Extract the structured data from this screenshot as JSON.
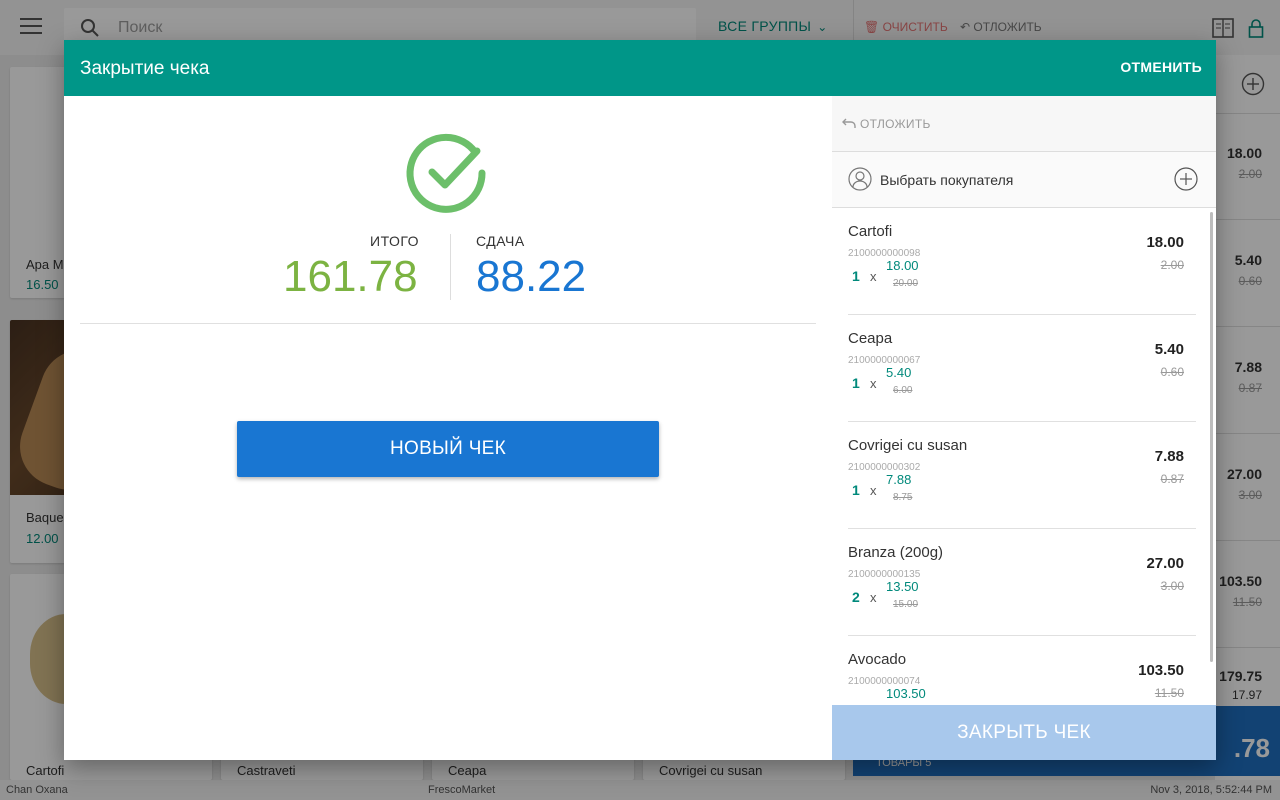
{
  "app": {
    "search_placeholder": "Поиск",
    "groups_label": "ВСЕ ГРУППЫ",
    "clear_label": "ОЧИСТИТЬ",
    "defer_label": "ОТЛОЖИТЬ",
    "tiles": [
      {
        "name": "Apa M",
        "price": "16.50"
      },
      {
        "name": "Baque",
        "price": "12.00"
      }
    ],
    "bottom_tiles": [
      "Cartofi",
      "Castraveti",
      "Ceapa",
      "Covrigei cu susan"
    ],
    "right_prices": [
      {
        "price": "18.00",
        "old": "2.00"
      },
      {
        "price": "5.40",
        "old": "0.60"
      },
      {
        "price": "7.88",
        "old": "0.87"
      },
      {
        "price": "27.00",
        "old": "3.00"
      },
      {
        "price": "103.50",
        "old": "11.50"
      },
      {
        "price": "179.75",
        "old": "17.97"
      }
    ],
    "total_big": ".78",
    "goods_label": "ТОВАРЫ  5",
    "status": {
      "cashier": "Chan Oxana",
      "store": "FrescoMarket",
      "datetime": "Nov 3, 2018, 5:52:44 PM"
    }
  },
  "modal": {
    "title": "Закрытие чека",
    "cancel_label": "ОТМЕНИТЬ",
    "total_label": "ИТОГО",
    "total_value": "161.78",
    "change_label": "СДАЧА",
    "change_value": "88.22",
    "new_check_label": "НОВЫЙ ЧЕК",
    "defer_label": "ОТЛОЖИТЬ",
    "customer_label": "Выбрать покупателя",
    "close_check_label": "ЗАКРЫТЬ ЧЕК",
    "items": [
      {
        "name": "Cartofi",
        "code": "2100000000098",
        "qty": "1",
        "unit_price": "18.00",
        "unit_old": "20.00",
        "total": "18.00",
        "discount": "2.00"
      },
      {
        "name": "Ceapa",
        "code": "2100000000067",
        "qty": "1",
        "unit_price": "5.40",
        "unit_old": "6.00",
        "total": "5.40",
        "discount": "0.60"
      },
      {
        "name": "Covrigei cu susan",
        "code": "2100000000302",
        "qty": "1",
        "unit_price": "7.88",
        "unit_old": "8.75",
        "total": "7.88",
        "discount": "0.87"
      },
      {
        "name": "Branza (200g)",
        "code": "2100000000135",
        "qty": "2",
        "unit_price": "13.50",
        "unit_old": "15.00",
        "total": "27.00",
        "discount": "3.00"
      },
      {
        "name": "Avocado",
        "code": "2100000000074",
        "qty": "",
        "unit_price": "103.50",
        "unit_old": "",
        "total": "103.50",
        "discount": "11.50"
      }
    ]
  },
  "colors": {
    "header": "#009688",
    "accent_green": "#7cb342",
    "accent_blue": "#1976d2",
    "teal_text": "#00897b"
  },
  "icons": [
    "menu-icon",
    "search-icon",
    "chevron-down-icon",
    "trash-icon",
    "undo-icon",
    "document-icon",
    "lock-icon",
    "plus-circle-icon",
    "check-circle-icon",
    "person-icon"
  ]
}
